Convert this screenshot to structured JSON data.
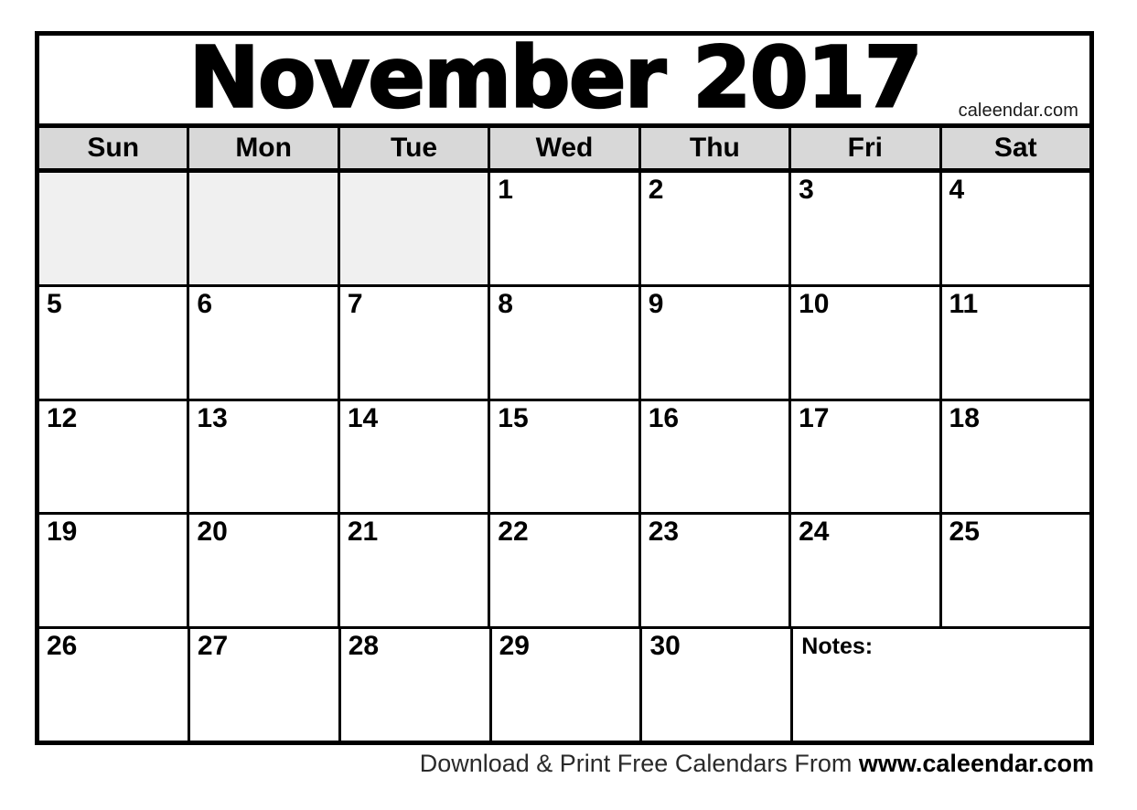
{
  "calendar": {
    "title": "November 2017",
    "month": "November",
    "year": "2017",
    "credit": "caleendar.com",
    "weekdays": [
      "Sun",
      "Mon",
      "Tue",
      "Wed",
      "Thu",
      "Fri",
      "Sat"
    ],
    "weeks": [
      [
        {
          "type": "blank",
          "label": ""
        },
        {
          "type": "blank",
          "label": ""
        },
        {
          "type": "blank",
          "label": ""
        },
        {
          "type": "day",
          "label": "1"
        },
        {
          "type": "day",
          "label": "2"
        },
        {
          "type": "day",
          "label": "3"
        },
        {
          "type": "day",
          "label": "4"
        }
      ],
      [
        {
          "type": "day",
          "label": "5"
        },
        {
          "type": "day",
          "label": "6"
        },
        {
          "type": "day",
          "label": "7"
        },
        {
          "type": "day",
          "label": "8"
        },
        {
          "type": "day",
          "label": "9"
        },
        {
          "type": "day",
          "label": "10"
        },
        {
          "type": "day",
          "label": "11"
        }
      ],
      [
        {
          "type": "day",
          "label": "12"
        },
        {
          "type": "day",
          "label": "13"
        },
        {
          "type": "day",
          "label": "14"
        },
        {
          "type": "day",
          "label": "15"
        },
        {
          "type": "day",
          "label": "16"
        },
        {
          "type": "day",
          "label": "17"
        },
        {
          "type": "day",
          "label": "18"
        }
      ],
      [
        {
          "type": "day",
          "label": "19"
        },
        {
          "type": "day",
          "label": "20"
        },
        {
          "type": "day",
          "label": "21"
        },
        {
          "type": "day",
          "label": "22"
        },
        {
          "type": "day",
          "label": "23"
        },
        {
          "type": "day",
          "label": "24"
        },
        {
          "type": "day",
          "label": "25"
        }
      ],
      [
        {
          "type": "day",
          "label": "26"
        },
        {
          "type": "day",
          "label": "27"
        },
        {
          "type": "day",
          "label": "28"
        },
        {
          "type": "day",
          "label": "29"
        },
        {
          "type": "day",
          "label": "30"
        },
        {
          "type": "notes",
          "label": "Notes:"
        }
      ]
    ],
    "colors": {
      "border": "#000000",
      "header_bg": "#d8d8d8",
      "blank_cell_bg": "#f0f0f0",
      "cell_bg": "#ffffff",
      "text": "#000000"
    }
  },
  "footer": {
    "lead": "Download  & Print Free Calendars From ",
    "site": "www.caleendar.com"
  }
}
